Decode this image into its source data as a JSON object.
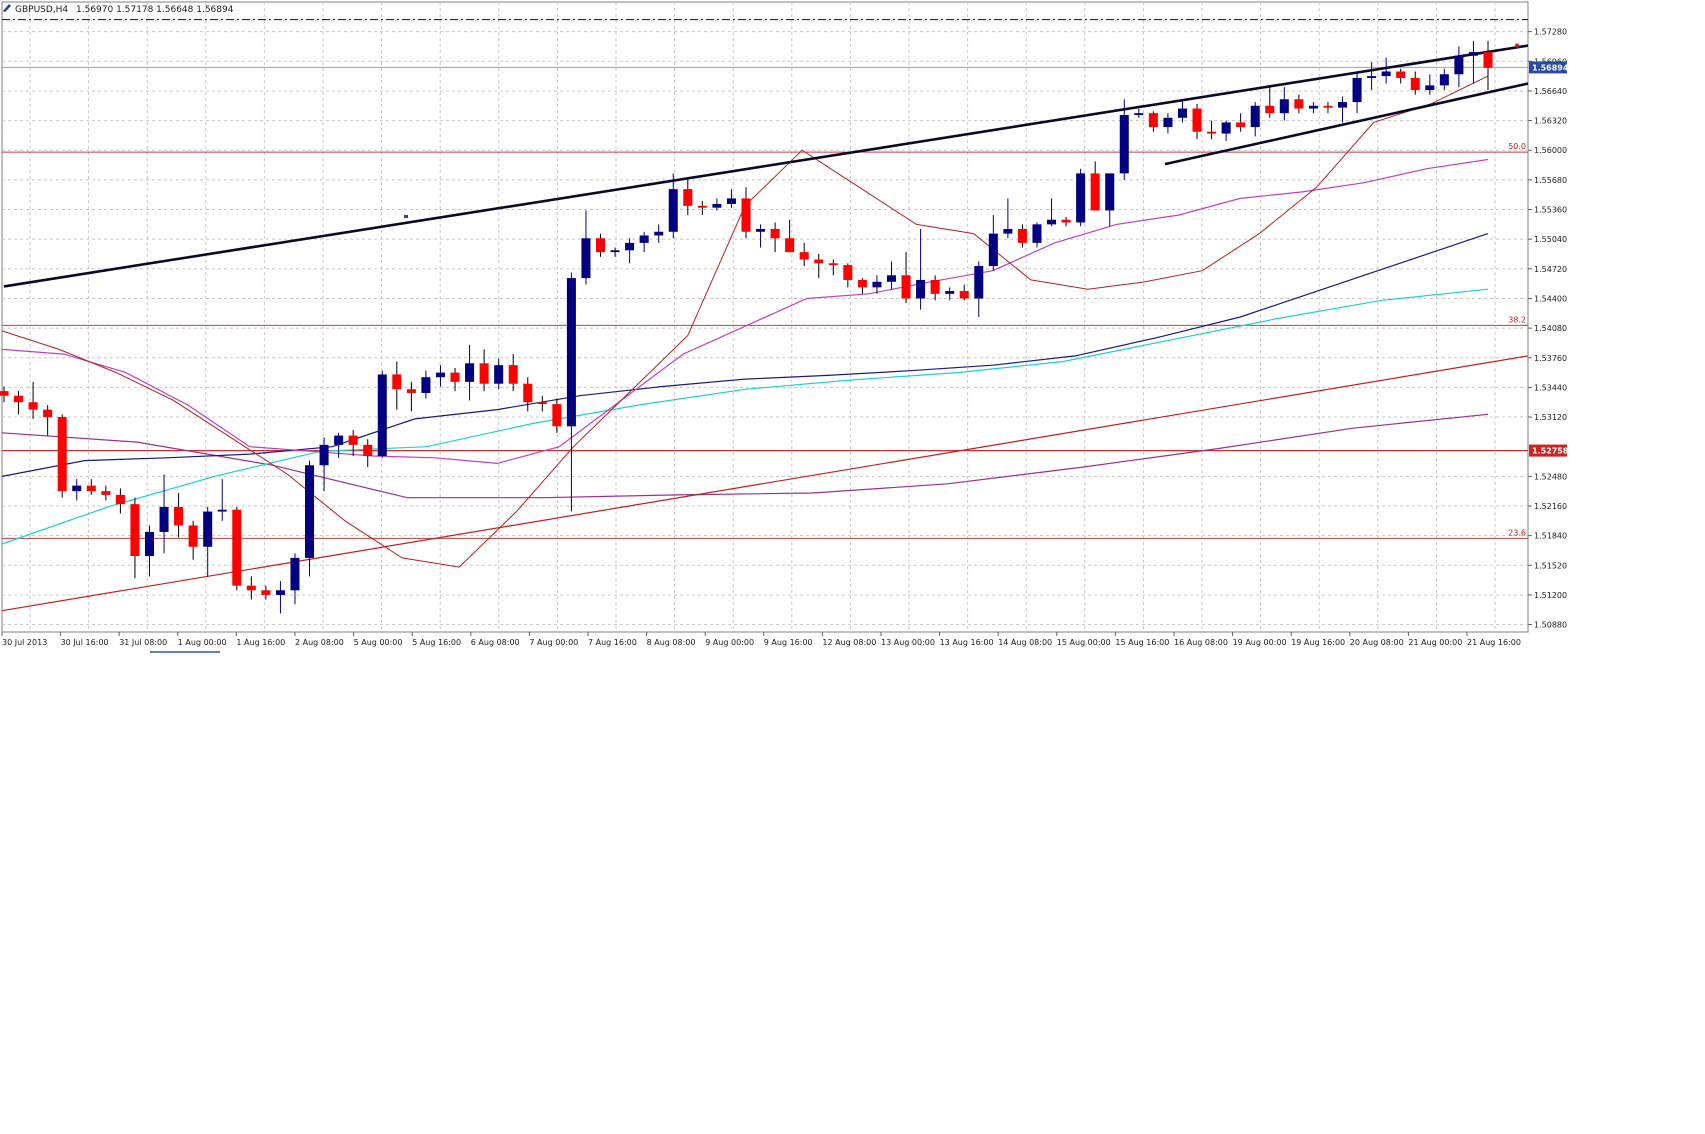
{
  "header": {
    "symbol": "GBPUSD,H4",
    "ohlc": "1.56970 1.57178 1.56648 1.56894"
  },
  "colors": {
    "bull": "#000080",
    "bear": "#ff0000",
    "grid": "#c8c8c8",
    "trendline": "#0a0a28",
    "ma_red": "#b22222",
    "ma_magenta": "#c040c0",
    "ma_navy": "#1a1a80",
    "ma_cyan": "#20d0d0",
    "ma_purple": "#9a3090",
    "fib": "#c04040",
    "dashdot": "#000060"
  },
  "chart_data": {
    "type": "candlestick",
    "y_range": [
      1.508,
      1.576
    ],
    "y_ticks": [
      "1.57280",
      "1.56960",
      "1.56640",
      "1.56320",
      "1.56000",
      "1.55680",
      "1.55360",
      "1.55040",
      "1.54720",
      "1.54400",
      "1.54080",
      "1.53760",
      "1.53440",
      "1.53120",
      "1.52480",
      "1.52160",
      "1.51840",
      "1.51520",
      "1.51200",
      "1.50880"
    ],
    "x_labels": [
      "30 Jul 2013",
      "30 Jul 16:00",
      "31 Jul 08:00",
      "1 Aug 00:00",
      "1 Aug 16:00",
      "2 Aug 08:00",
      "5 Aug 00:00",
      "5 Aug 16:00",
      "6 Aug 08:00",
      "7 Aug 00:00",
      "7 Aug 16:00",
      "8 Aug 08:00",
      "9 Aug 00:00",
      "9 Aug 16:00",
      "12 Aug 08:00",
      "13 Aug 00:00",
      "13 Aug 16:00",
      "14 Aug 08:00",
      "15 Aug 00:00",
      "15 Aug 16:00",
      "16 Aug 08:00",
      "19 Aug 00:00",
      "19 Aug 16:00",
      "20 Aug 08:00",
      "21 Aug 00:00",
      "21 Aug 16:00"
    ],
    "current_price": "1.56894",
    "highlight_price": "1.52758",
    "fib_levels": [
      {
        "label": "50.0",
        "value": 1.5598
      },
      {
        "label": "38.2",
        "value": 1.5411
      },
      {
        "label": "23.6",
        "value": 1.5181
      }
    ],
    "dashdot_level": 1.5741,
    "candles": [
      [
        1.534,
        1.5345,
        1.5328,
        1.5335
      ],
      [
        1.5335,
        1.534,
        1.5315,
        1.5328
      ],
      [
        1.5328,
        1.535,
        1.531,
        1.532
      ],
      [
        1.532,
        1.5325,
        1.5292,
        1.5312
      ],
      [
        1.5312,
        1.5315,
        1.5225,
        1.5232
      ],
      [
        1.5232,
        1.5245,
        1.5222,
        1.5238
      ],
      [
        1.5238,
        1.5245,
        1.5228,
        1.5232
      ],
      [
        1.5232,
        1.5238,
        1.5222,
        1.5228
      ],
      [
        1.5228,
        1.5235,
        1.5208,
        1.5218
      ],
      [
        1.5218,
        1.5225,
        1.5138,
        1.5162
      ],
      [
        1.5162,
        1.5195,
        1.514,
        1.5188
      ],
      [
        1.5188,
        1.525,
        1.5165,
        1.5215
      ],
      [
        1.5215,
        1.523,
        1.5182,
        1.5195
      ],
      [
        1.5195,
        1.52,
        1.5158,
        1.5172
      ],
      [
        1.5172,
        1.5215,
        1.514,
        1.521
      ],
      [
        1.521,
        1.5245,
        1.52,
        1.5212
      ],
      [
        1.5212,
        1.5215,
        1.5125,
        1.513
      ],
      [
        1.513,
        1.514,
        1.5115,
        1.5125
      ],
      [
        1.5125,
        1.513,
        1.5115,
        1.512
      ],
      [
        1.512,
        1.5135,
        1.51,
        1.5125
      ],
      [
        1.5125,
        1.5165,
        1.511,
        1.516
      ],
      [
        1.516,
        1.5265,
        1.514,
        1.526
      ],
      [
        1.526,
        1.529,
        1.5232,
        1.5282
      ],
      [
        1.5282,
        1.5295,
        1.5268,
        1.5292
      ],
      [
        1.5292,
        1.5298,
        1.527,
        1.5282
      ],
      [
        1.5282,
        1.5288,
        1.5258,
        1.527
      ],
      [
        1.527,
        1.5362,
        1.5268,
        1.5358
      ],
      [
        1.5358,
        1.5372,
        1.532,
        1.5342
      ],
      [
        1.5342,
        1.535,
        1.5318,
        1.5338
      ],
      [
        1.5338,
        1.5362,
        1.5332,
        1.5355
      ],
      [
        1.5355,
        1.5368,
        1.5345,
        1.536
      ],
      [
        1.536,
        1.5365,
        1.534,
        1.535
      ],
      [
        1.535,
        1.539,
        1.533,
        1.537
      ],
      [
        1.537,
        1.5385,
        1.534,
        1.5348
      ],
      [
        1.5348,
        1.5375,
        1.5342,
        1.5368
      ],
      [
        1.5368,
        1.538,
        1.534,
        1.5348
      ],
      [
        1.5348,
        1.5355,
        1.5318,
        1.5328
      ],
      [
        1.5328,
        1.5335,
        1.5318,
        1.5326
      ],
      [
        1.5326,
        1.5332,
        1.5295,
        1.5302
      ],
      [
        1.5302,
        1.5468,
        1.521,
        1.5462
      ],
      [
        1.5462,
        1.5535,
        1.5455,
        1.5505
      ],
      [
        1.5505,
        1.551,
        1.5485,
        1.549
      ],
      [
        1.549,
        1.5495,
        1.5485,
        1.5492
      ],
      [
        1.5492,
        1.5505,
        1.5478,
        1.55
      ],
      [
        1.55,
        1.5512,
        1.549,
        1.5508
      ],
      [
        1.5508,
        1.552,
        1.55,
        1.5512
      ],
      [
        1.5512,
        1.5575,
        1.5505,
        1.5558
      ],
      [
        1.5558,
        1.5568,
        1.553,
        1.554
      ],
      [
        1.554,
        1.5545,
        1.553,
        1.5538
      ],
      [
        1.5538,
        1.5548,
        1.5535,
        1.5542
      ],
      [
        1.5542,
        1.5558,
        1.5538,
        1.5548
      ],
      [
        1.5548,
        1.556,
        1.5505,
        1.5512
      ],
      [
        1.5512,
        1.552,
        1.5495,
        1.5515
      ],
      [
        1.5515,
        1.5522,
        1.549,
        1.5505
      ],
      [
        1.5505,
        1.5525,
        1.5492,
        1.549
      ],
      [
        1.549,
        1.55,
        1.5475,
        1.5482
      ],
      [
        1.5482,
        1.5488,
        1.5462,
        1.5478
      ],
      [
        1.5478,
        1.5482,
        1.5465,
        1.5476
      ],
      [
        1.5476,
        1.5478,
        1.5452,
        1.546
      ],
      [
        1.546,
        1.5462,
        1.5445,
        1.5452
      ],
      [
        1.5452,
        1.5465,
        1.5445,
        1.5458
      ],
      [
        1.5458,
        1.548,
        1.545,
        1.5465
      ],
      [
        1.5465,
        1.549,
        1.5435,
        1.544
      ],
      [
        1.544,
        1.5515,
        1.5428,
        1.546
      ],
      [
        1.546,
        1.5465,
        1.5438,
        1.5445
      ],
      [
        1.5445,
        1.5452,
        1.5438,
        1.5448
      ],
      [
        1.5448,
        1.5455,
        1.5438,
        1.544
      ],
      [
        1.544,
        1.548,
        1.542,
        1.5475
      ],
      [
        1.5475,
        1.553,
        1.547,
        1.551
      ],
      [
        1.551,
        1.5548,
        1.5505,
        1.5515
      ],
      [
        1.5515,
        1.552,
        1.5495,
        1.55
      ],
      [
        1.55,
        1.5522,
        1.5495,
        1.552
      ],
      [
        1.552,
        1.5548,
        1.5518,
        1.5525
      ],
      [
        1.5525,
        1.5528,
        1.5518,
        1.5522
      ],
      [
        1.5522,
        1.558,
        1.5518,
        1.5575
      ],
      [
        1.5575,
        1.5588,
        1.5535,
        1.5535
      ],
      [
        1.5535,
        1.557,
        1.5518,
        1.5575
      ],
      [
        1.5575,
        1.5655,
        1.5568,
        1.5638
      ],
      [
        1.5638,
        1.5645,
        1.5635,
        1.564
      ],
      [
        1.564,
        1.5642,
        1.562,
        1.5625
      ],
      [
        1.5625,
        1.564,
        1.5618,
        1.5635
      ],
      [
        1.5635,
        1.5655,
        1.563,
        1.5645
      ],
      [
        1.5645,
        1.565,
        1.5612,
        1.562
      ],
      [
        1.562,
        1.5632,
        1.5612,
        1.5618
      ],
      [
        1.5618,
        1.5632,
        1.561,
        1.563
      ],
      [
        1.563,
        1.564,
        1.562,
        1.5625
      ],
      [
        1.5625,
        1.5652,
        1.5615,
        1.5648
      ],
      [
        1.5648,
        1.567,
        1.5635,
        1.564
      ],
      [
        1.564,
        1.5668,
        1.5632,
        1.5655
      ],
      [
        1.5655,
        1.566,
        1.564,
        1.5645
      ],
      [
        1.5645,
        1.5652,
        1.564,
        1.5648
      ],
      [
        1.5648,
        1.5652,
        1.564,
        1.5646
      ],
      [
        1.5646,
        1.5658,
        1.563,
        1.5652
      ],
      [
        1.5652,
        1.5685,
        1.564,
        1.5678
      ],
      [
        1.5678,
        1.5695,
        1.5665,
        1.568
      ],
      [
        1.568,
        1.57,
        1.5672,
        1.5685
      ],
      [
        1.5685,
        1.5688,
        1.5672,
        1.5678
      ],
      [
        1.5678,
        1.5685,
        1.566,
        1.5665
      ],
      [
        1.5665,
        1.5682,
        1.566,
        1.567
      ],
      [
        1.567,
        1.5688,
        1.5665,
        1.5682
      ],
      [
        1.5682,
        1.5712,
        1.5668,
        1.5702
      ],
      [
        1.5702,
        1.5718,
        1.5672,
        1.5706
      ],
      [
        1.5706,
        1.5718,
        1.5665,
        1.5689
      ]
    ],
    "ma_red": [
      1.5405,
      1.5385,
      1.536,
      1.533,
      1.529,
      1.525,
      1.52,
      1.516,
      1.515,
      1.521,
      1.528,
      1.534,
      1.54,
      1.554,
      1.56,
      1.556,
      1.552,
      1.551,
      1.546,
      1.545,
      1.5458,
      1.547,
      1.551,
      1.556,
      1.563,
      1.565,
      1.568
    ],
    "ma_magenta": [
      1.5385,
      1.538,
      1.536,
      1.5325,
      1.528,
      1.5275,
      1.527,
      1.5268,
      1.5262,
      1.528,
      1.533,
      1.538,
      1.541,
      1.544,
      1.5445,
      1.5458,
      1.547,
      1.55,
      1.552,
      1.553,
      1.5548,
      1.5555,
      1.5565,
      1.558,
      1.559
    ],
    "ma_navy": [
      1.5248,
      1.5265,
      1.5268,
      1.5272,
      1.528,
      1.531,
      1.532,
      1.5335,
      1.5345,
      1.5353,
      1.5357,
      1.5362,
      1.5368,
      1.5378,
      1.5398,
      1.542,
      1.545,
      1.548,
      1.551
    ],
    "ma_cyan": [
      1.5175,
      1.5215,
      1.5248,
      1.5275,
      1.528,
      1.5305,
      1.5325,
      1.5342,
      1.5352,
      1.536,
      1.5372,
      1.5395,
      1.5418,
      1.5438,
      1.545
    ],
    "ma_purple": [
      1.5295,
      1.5285,
      1.526,
      1.5225,
      1.5225,
      1.5228,
      1.523,
      1.524,
      1.5258,
      1.5278,
      1.53,
      1.5315
    ]
  }
}
